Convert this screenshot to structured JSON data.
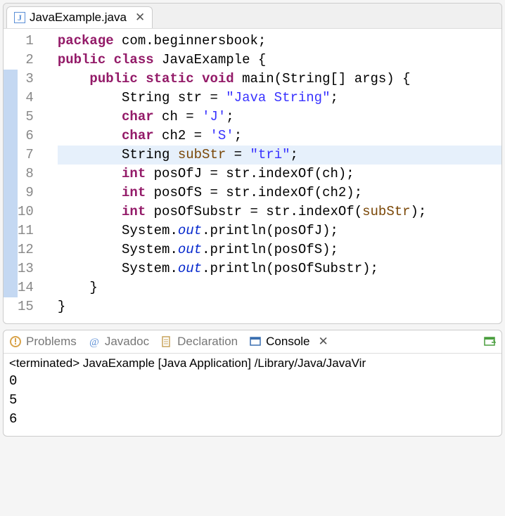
{
  "editor": {
    "tab": {
      "filename": "JavaExample.java"
    }
  },
  "code": {
    "lines": [
      {
        "n": "1",
        "marker": false,
        "fold": false,
        "hl": false,
        "segs": [
          {
            "t": "package ",
            "c": "kw"
          },
          {
            "t": "com.beginnersbook;",
            "c": "plain"
          }
        ]
      },
      {
        "n": "2",
        "marker": false,
        "fold": false,
        "hl": false,
        "segs": [
          {
            "t": "public class ",
            "c": "kw"
          },
          {
            "t": "JavaExample {",
            "c": "plain"
          }
        ]
      },
      {
        "n": "3",
        "marker": true,
        "fold": true,
        "hl": false,
        "segs": [
          {
            "t": "    ",
            "c": "plain"
          },
          {
            "t": "public static ",
            "c": "kw"
          },
          {
            "t": "void ",
            "c": "type"
          },
          {
            "t": "main(String[] args) {",
            "c": "plain"
          }
        ]
      },
      {
        "n": "4",
        "marker": true,
        "fold": false,
        "hl": false,
        "segs": [
          {
            "t": "        String str = ",
            "c": "plain"
          },
          {
            "t": "\"Java String\"",
            "c": "str"
          },
          {
            "t": ";",
            "c": "plain"
          }
        ]
      },
      {
        "n": "5",
        "marker": true,
        "fold": false,
        "hl": false,
        "segs": [
          {
            "t": "        ",
            "c": "plain"
          },
          {
            "t": "char",
            "c": "type"
          },
          {
            "t": " ch = ",
            "c": "plain"
          },
          {
            "t": "'J'",
            "c": "str"
          },
          {
            "t": ";",
            "c": "plain"
          }
        ]
      },
      {
        "n": "6",
        "marker": true,
        "fold": false,
        "hl": false,
        "segs": [
          {
            "t": "        ",
            "c": "plain"
          },
          {
            "t": "char",
            "c": "type"
          },
          {
            "t": " ch2 = ",
            "c": "plain"
          },
          {
            "t": "'S'",
            "c": "str"
          },
          {
            "t": ";",
            "c": "plain"
          }
        ]
      },
      {
        "n": "7",
        "marker": true,
        "fold": false,
        "hl": true,
        "segs": [
          {
            "t": "        String ",
            "c": "plain"
          },
          {
            "t": "subStr",
            "c": "var"
          },
          {
            "t": " = ",
            "c": "plain"
          },
          {
            "t": "\"tri\"",
            "c": "str"
          },
          {
            "t": ";",
            "c": "plain"
          }
        ]
      },
      {
        "n": "8",
        "marker": true,
        "fold": false,
        "hl": false,
        "segs": [
          {
            "t": "        ",
            "c": "plain"
          },
          {
            "t": "int",
            "c": "type"
          },
          {
            "t": " posOfJ = str.indexOf(ch);",
            "c": "plain"
          }
        ]
      },
      {
        "n": "9",
        "marker": true,
        "fold": false,
        "hl": false,
        "segs": [
          {
            "t": "        ",
            "c": "plain"
          },
          {
            "t": "int",
            "c": "type"
          },
          {
            "t": " posOfS = str.indexOf(ch2);",
            "c": "plain"
          }
        ]
      },
      {
        "n": "10",
        "marker": true,
        "fold": false,
        "hl": false,
        "segs": [
          {
            "t": "        ",
            "c": "plain"
          },
          {
            "t": "int",
            "c": "type"
          },
          {
            "t": " posOfSubstr = str.indexOf(",
            "c": "plain"
          },
          {
            "t": "subStr",
            "c": "var"
          },
          {
            "t": ");",
            "c": "plain"
          }
        ]
      },
      {
        "n": "11",
        "marker": true,
        "fold": false,
        "hl": false,
        "segs": [
          {
            "t": "        System.",
            "c": "plain"
          },
          {
            "t": "out",
            "c": "field"
          },
          {
            "t": ".println(posOfJ);",
            "c": "plain"
          }
        ]
      },
      {
        "n": "12",
        "marker": true,
        "fold": false,
        "hl": false,
        "segs": [
          {
            "t": "        System.",
            "c": "plain"
          },
          {
            "t": "out",
            "c": "field"
          },
          {
            "t": ".println(posOfS);",
            "c": "plain"
          }
        ]
      },
      {
        "n": "13",
        "marker": true,
        "fold": false,
        "hl": false,
        "segs": [
          {
            "t": "        System.",
            "c": "plain"
          },
          {
            "t": "out",
            "c": "field"
          },
          {
            "t": ".println(posOfSubstr);",
            "c": "plain"
          }
        ]
      },
      {
        "n": "14",
        "marker": true,
        "fold": false,
        "hl": false,
        "segs": [
          {
            "t": "    }",
            "c": "plain"
          }
        ]
      },
      {
        "n": "15",
        "marker": false,
        "fold": false,
        "hl": false,
        "segs": [
          {
            "t": "}",
            "c": "plain"
          }
        ]
      }
    ]
  },
  "bottom": {
    "tabs": {
      "problems": "Problems",
      "javadoc": "Javadoc",
      "declaration": "Declaration",
      "console": "Console"
    },
    "status": "<terminated> JavaExample [Java Application] /Library/Java/JavaVir",
    "output": [
      "0",
      "5",
      "6"
    ]
  }
}
